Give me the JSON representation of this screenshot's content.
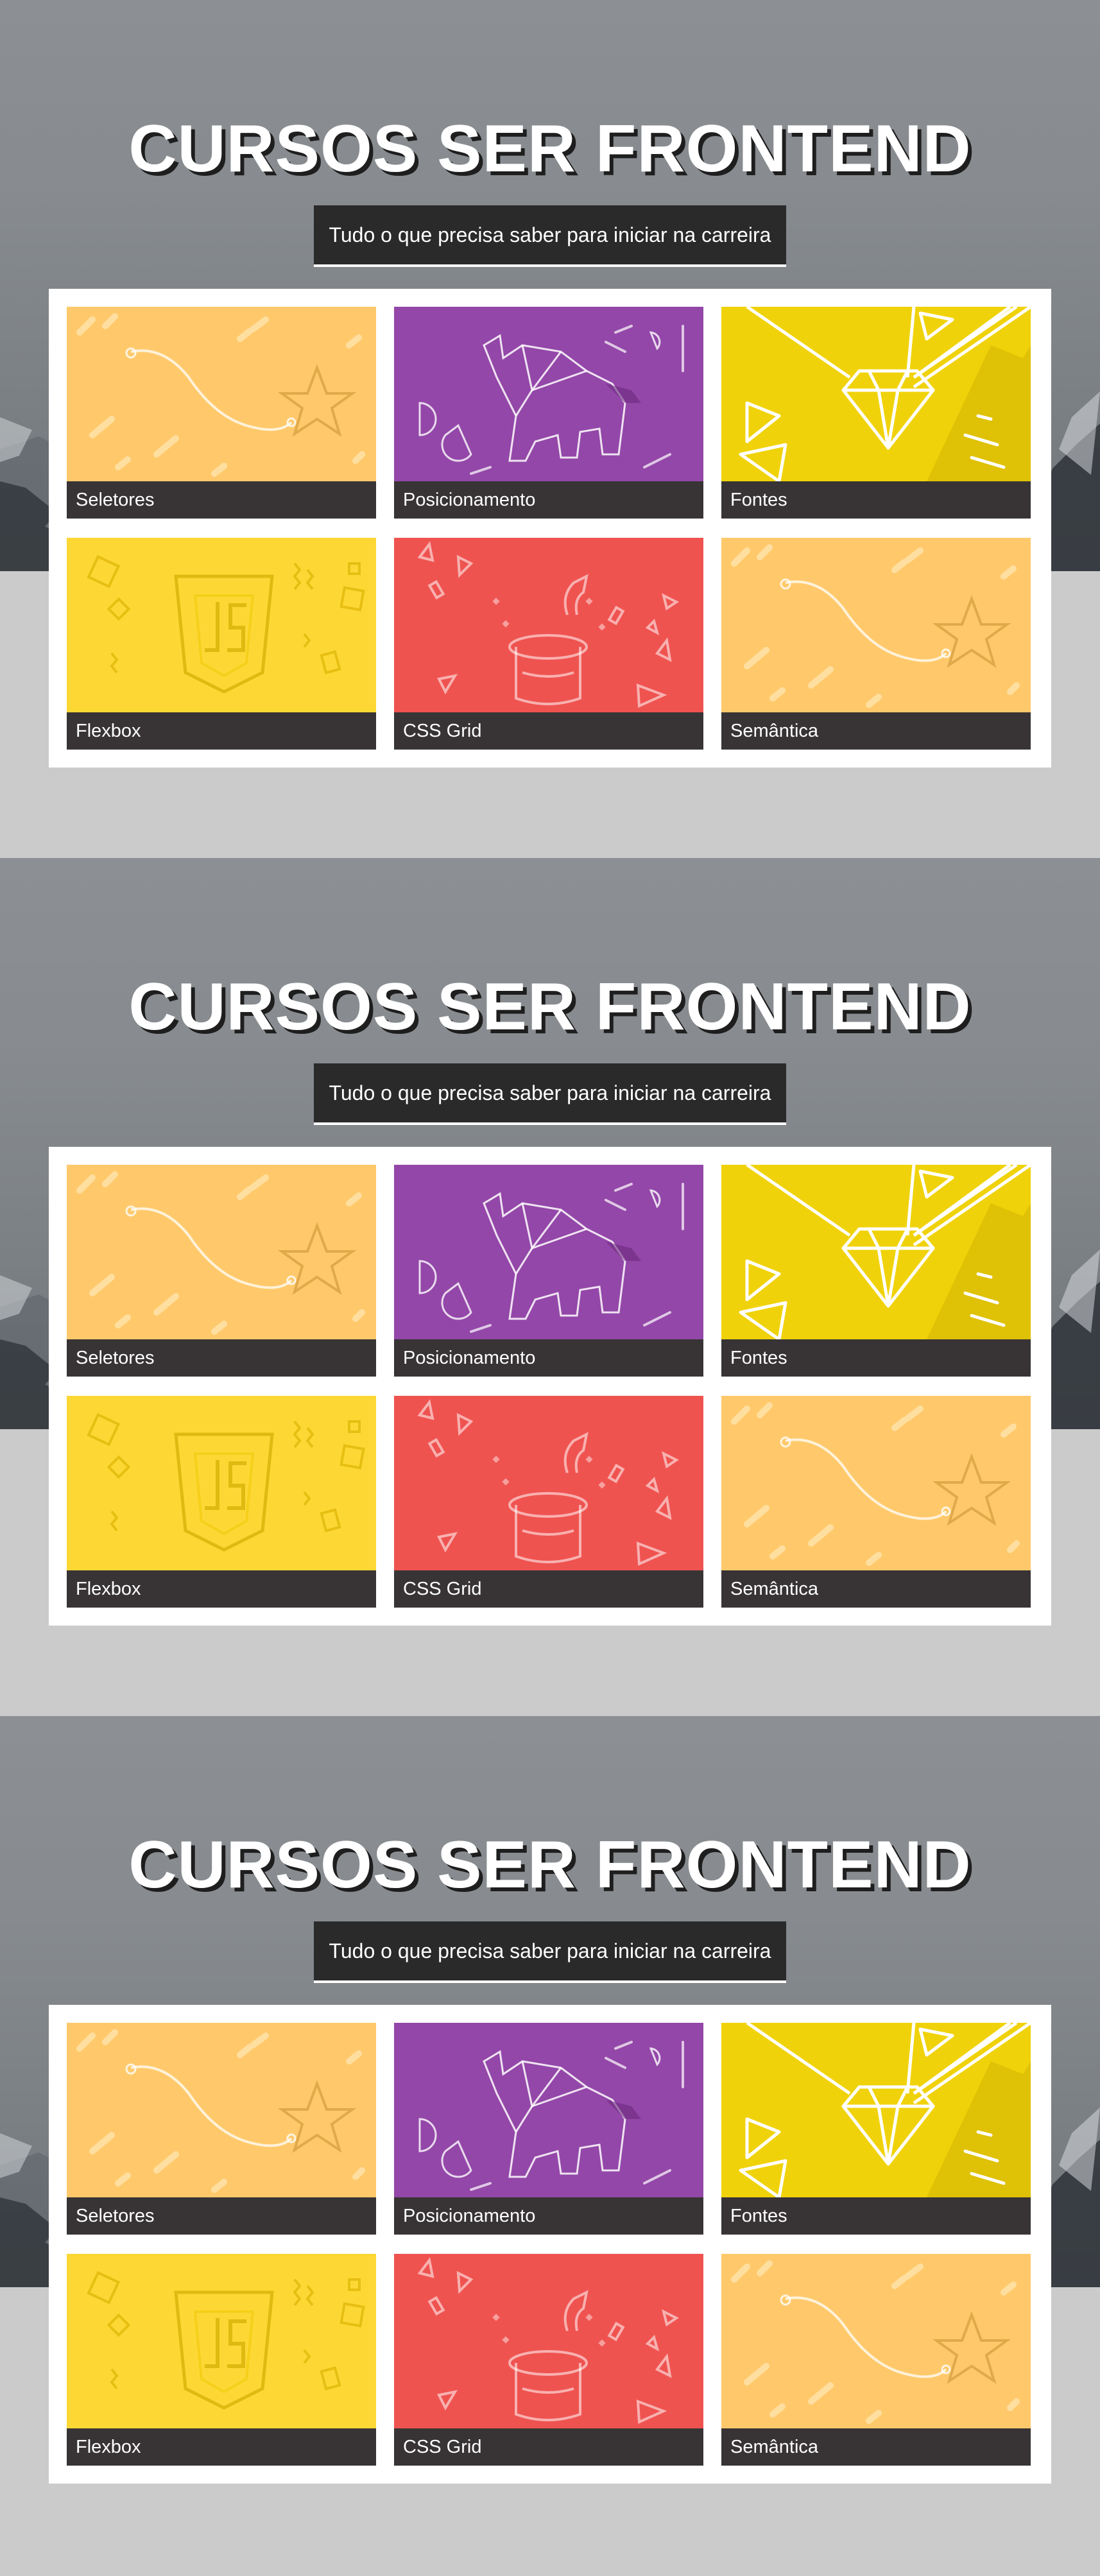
{
  "sections": [
    {
      "title": "CURSOS SER FRONTEND",
      "subtitle": "Tudo o que precisa saber para iniciar na carreira",
      "courses": [
        {
          "label": "Seletores",
          "color": "#ffc96b",
          "icon": "path-star-icon"
        },
        {
          "label": "Posicionamento",
          "color": "#9347a8",
          "icon": "origami-elephant-icon"
        },
        {
          "label": "Fontes",
          "color": "#f0d20a",
          "icon": "diamond-pencil-icon"
        },
        {
          "label": "Flexbox",
          "color": "#fdd835",
          "icon": "js-shield-icon"
        },
        {
          "label": "CSS Grid",
          "color": "#ef5350",
          "icon": "magic-hat-icon"
        },
        {
          "label": "Semântica",
          "color": "#ffc96b",
          "icon": "path-star-icon"
        }
      ]
    },
    {
      "title": "CURSOS SER FRONTEND",
      "subtitle": "Tudo o que precisa saber para iniciar na carreira",
      "courses": [
        {
          "label": "Seletores",
          "color": "#ffc96b",
          "icon": "path-star-icon"
        },
        {
          "label": "Posicionamento",
          "color": "#9347a8",
          "icon": "origami-elephant-icon"
        },
        {
          "label": "Fontes",
          "color": "#f0d20a",
          "icon": "diamond-pencil-icon"
        },
        {
          "label": "Flexbox",
          "color": "#fdd835",
          "icon": "js-shield-icon"
        },
        {
          "label": "CSS Grid",
          "color": "#ef5350",
          "icon": "magic-hat-icon"
        },
        {
          "label": "Semântica",
          "color": "#ffc96b",
          "icon": "path-star-icon"
        }
      ]
    },
    {
      "title": "CURSOS SER FRONTEND",
      "subtitle": "Tudo o que precisa saber para iniciar na carreira",
      "courses": [
        {
          "label": "Seletores",
          "color": "#ffc96b",
          "icon": "path-star-icon"
        },
        {
          "label": "Posicionamento",
          "color": "#9347a8",
          "icon": "origami-elephant-icon"
        },
        {
          "label": "Fontes",
          "color": "#f0d20a",
          "icon": "diamond-pencil-icon"
        },
        {
          "label": "Flexbox",
          "color": "#fdd835",
          "icon": "js-shield-icon"
        },
        {
          "label": "CSS Grid",
          "color": "#ef5350",
          "icon": "magic-hat-icon"
        },
        {
          "label": "Semântica",
          "color": "#ffc96b",
          "icon": "path-star-icon"
        }
      ]
    }
  ]
}
